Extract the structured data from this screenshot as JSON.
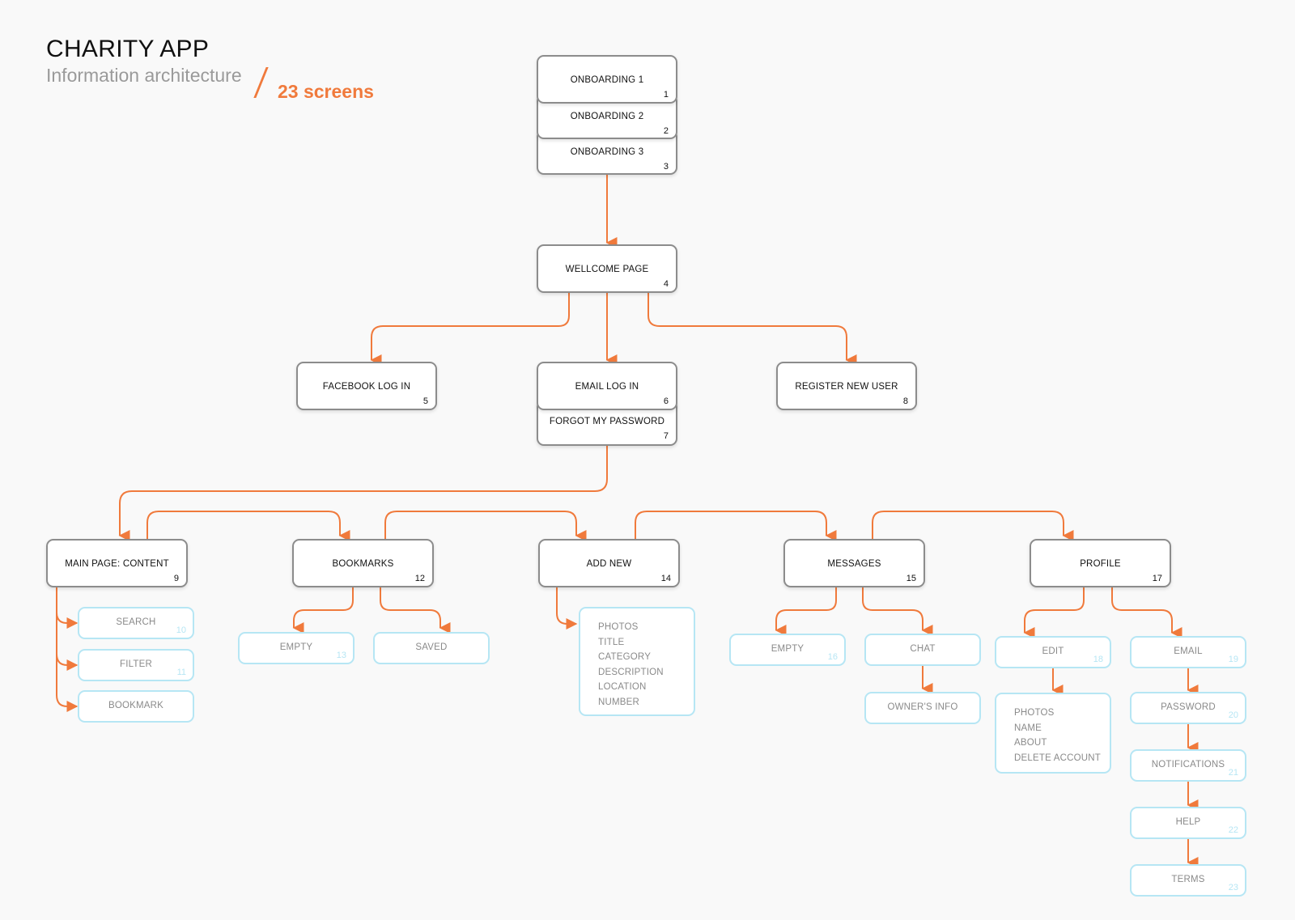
{
  "header": {
    "title": "CHARITY APP",
    "subtitle": "Information architecture",
    "screen_count": "23 screens"
  },
  "colors": {
    "accent": "#f07a3c",
    "primary_border": "#8c8c8c",
    "secondary_border": "#b6e6f4",
    "background": "#f9f9f9"
  },
  "onboarding": [
    {
      "label": "ONBOARDING 1",
      "num": "1"
    },
    {
      "label": "ONBOARDING 2",
      "num": "2"
    },
    {
      "label": "ONBOARDING 3",
      "num": "3"
    }
  ],
  "welcome": {
    "label": "WELLCOME PAGE",
    "num": "4"
  },
  "auth": {
    "facebook": {
      "label": "FACEBOOK LOG IN",
      "num": "5"
    },
    "email": {
      "label": "EMAIL LOG IN",
      "num": "6"
    },
    "forgot": {
      "label": "FORGOT MY PASSWORD",
      "num": "7"
    },
    "register": {
      "label": "REGISTER NEW USER",
      "num": "8"
    }
  },
  "sections": {
    "main": {
      "label": "MAIN PAGE: CONTENT",
      "num": "9",
      "children": [
        {
          "label": "SEARCH",
          "num": "10"
        },
        {
          "label": "FILTER",
          "num": "11"
        },
        {
          "label": "BOOKMARK",
          "num": ""
        }
      ]
    },
    "bookmarks": {
      "label": "BOOKMARKS",
      "num": "12",
      "children": [
        {
          "label": "EMPTY",
          "num": "13"
        },
        {
          "label": "SAVED",
          "num": ""
        }
      ]
    },
    "add_new": {
      "label": "ADD NEW",
      "num": "14",
      "fields": [
        "PHOTOS",
        "TITLE",
        "CATEGORY",
        "DESCRIPTION",
        "LOCATION",
        "NUMBER"
      ]
    },
    "messages": {
      "label": "MESSAGES",
      "num": "15",
      "children": [
        {
          "label": "EMPTY",
          "num": "16"
        },
        {
          "label": "CHAT",
          "num": ""
        },
        {
          "label": "OWNER'S INFO",
          "num": ""
        }
      ]
    },
    "profile": {
      "label": "PROFILE",
      "num": "17",
      "edit": {
        "label": "EDIT",
        "num": "18"
      },
      "edit_fields": [
        "PHOTOS",
        "NAME",
        "ABOUT",
        "DELETE ACCOUNT"
      ],
      "settings": [
        {
          "label": "EMAIL",
          "num": "19"
        },
        {
          "label": "PASSWORD",
          "num": "20"
        },
        {
          "label": "NOTIFICATIONS",
          "num": "21"
        },
        {
          "label": "HELP",
          "num": "22"
        },
        {
          "label": "TERMS",
          "num": "23"
        }
      ]
    }
  }
}
